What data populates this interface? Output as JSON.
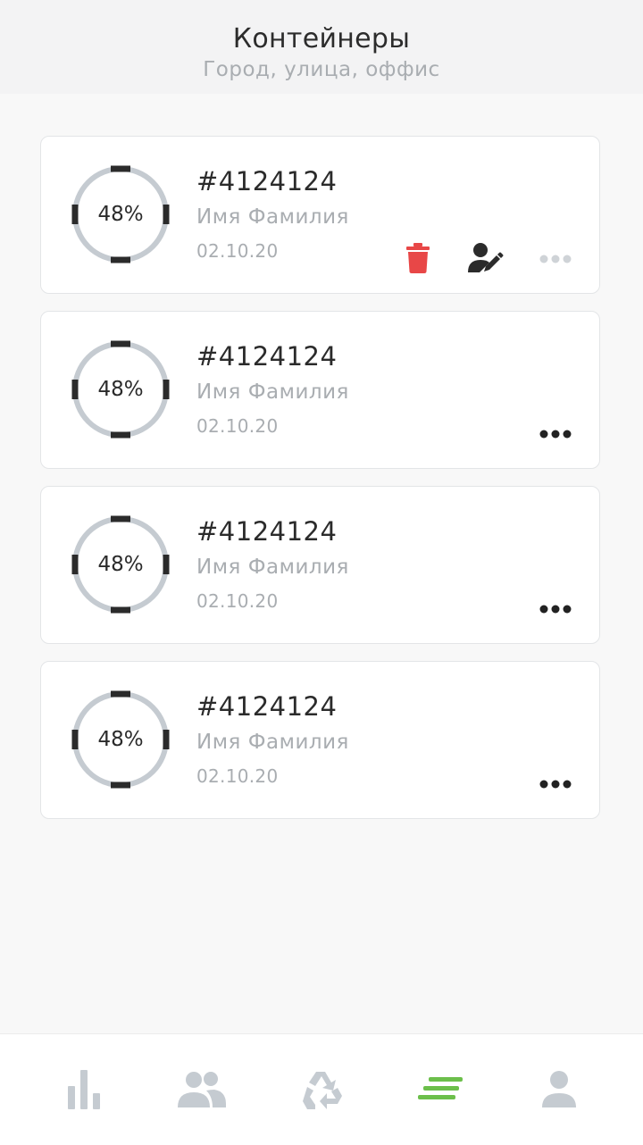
{
  "header": {
    "title": "Контейнеры",
    "subtitle": "Город, улица, оффис"
  },
  "containers": [
    {
      "percent_label": "48%",
      "fill_fraction": 0.48,
      "number": "#4124124",
      "name": "Имя Фамилия",
      "date": "02.10.20",
      "actions_expanded": true
    },
    {
      "percent_label": "48%",
      "fill_fraction": 0.48,
      "number": "#4124124",
      "name": "Имя Фамилия",
      "date": "02.10.20",
      "actions_expanded": false
    },
    {
      "percent_label": "48%",
      "fill_fraction": 0.48,
      "number": "#4124124",
      "name": "Имя Фамилия",
      "date": "02.10.20",
      "actions_expanded": false
    },
    {
      "percent_label": "48%",
      "fill_fraction": 0.48,
      "number": "#4124124",
      "name": "Имя Фамилия",
      "date": "02.10.20",
      "actions_expanded": false
    }
  ],
  "card_actions": {
    "delete_icon": "trash-icon",
    "edit_icon": "user-edit-icon",
    "more_icon": "more-dots-icon"
  },
  "bottom_nav": {
    "items": [
      {
        "icon": "bar-chart-icon",
        "active": false
      },
      {
        "icon": "users-icon",
        "active": false
      },
      {
        "icon": "recycle-icon",
        "active": false
      },
      {
        "icon": "list-icon",
        "active": true
      },
      {
        "icon": "profile-icon",
        "active": false
      }
    ]
  },
  "colors": {
    "accent_green": "#6cbf4b",
    "delete_red": "#e84747",
    "ring_track": "#c5cbd1",
    "ring_marks": "#2b2b2b",
    "muted_text": "#a9adb1",
    "nav_inactive": "#c5cbd1"
  }
}
